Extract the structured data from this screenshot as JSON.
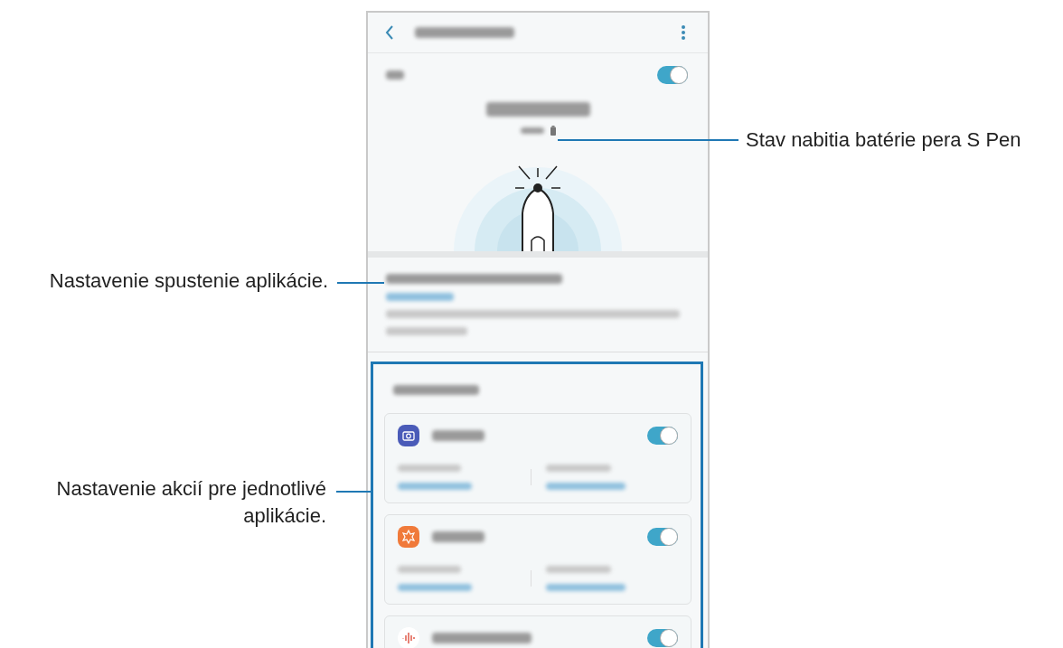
{
  "phone": {
    "power_toggle": {
      "on": true
    },
    "apps": [
      {
        "kind": "camera",
        "on": true
      },
      {
        "kind": "gallery",
        "on": true
      },
      {
        "kind": "recorder",
        "on": true
      }
    ]
  },
  "callouts": [
    {
      "text": "Stav nabitia batérie pera S Pen"
    },
    {
      "text": "Nastavenie spustenie aplikácie."
    },
    {
      "text": "Nastavenie akcií pre jednotlivé aplikácie."
    }
  ]
}
